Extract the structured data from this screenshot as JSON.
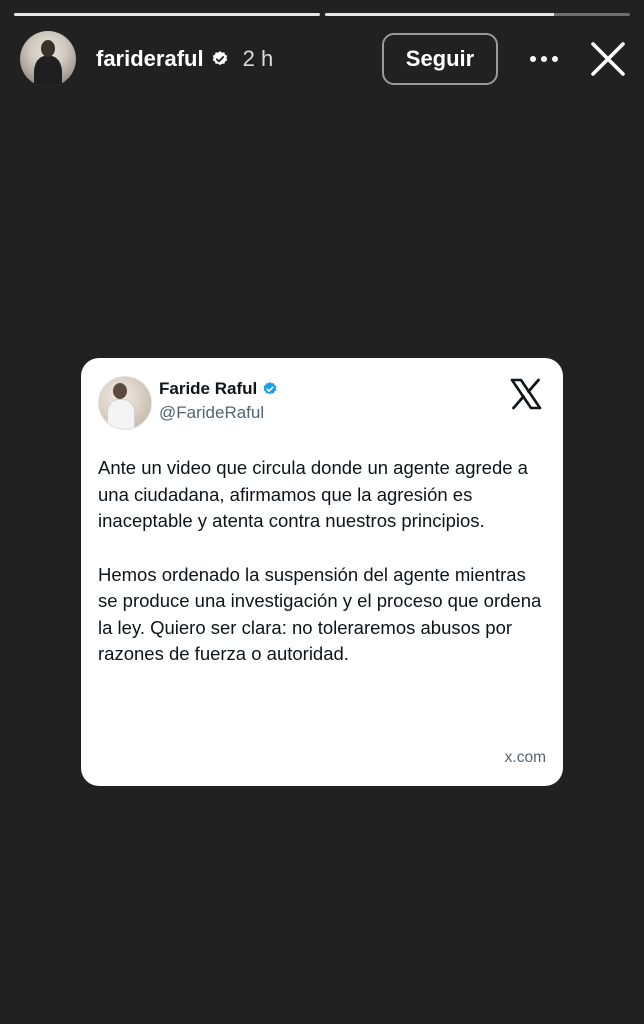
{
  "story": {
    "progress": [
      1.0,
      0.75
    ]
  },
  "header": {
    "username": "farideraful",
    "time": "2 h",
    "follow_label": "Seguir"
  },
  "post": {
    "name": "Faride Raful",
    "handle": "@FarideRaful",
    "paragraphs": [
      "Ante un video que circula donde un agente agrede a una ciudadana, afirmamos que la agresión es inaceptable y atenta contra nuestros principios.",
      "Hemos ordenado la suspensión del agente mientras se produce una investigación y el proceso que ordena la ley. Quiero ser clara: no toleraremos abusos por razones de fuerza o autoridad."
    ],
    "domain": "x.com"
  },
  "icons": {
    "verified": "verified-badge-icon",
    "more": "more-options-icon",
    "close": "close-icon",
    "x_logo": "x-logo-icon"
  },
  "colors": {
    "background": "#212121",
    "verified_blue": "#1d9bf0"
  }
}
